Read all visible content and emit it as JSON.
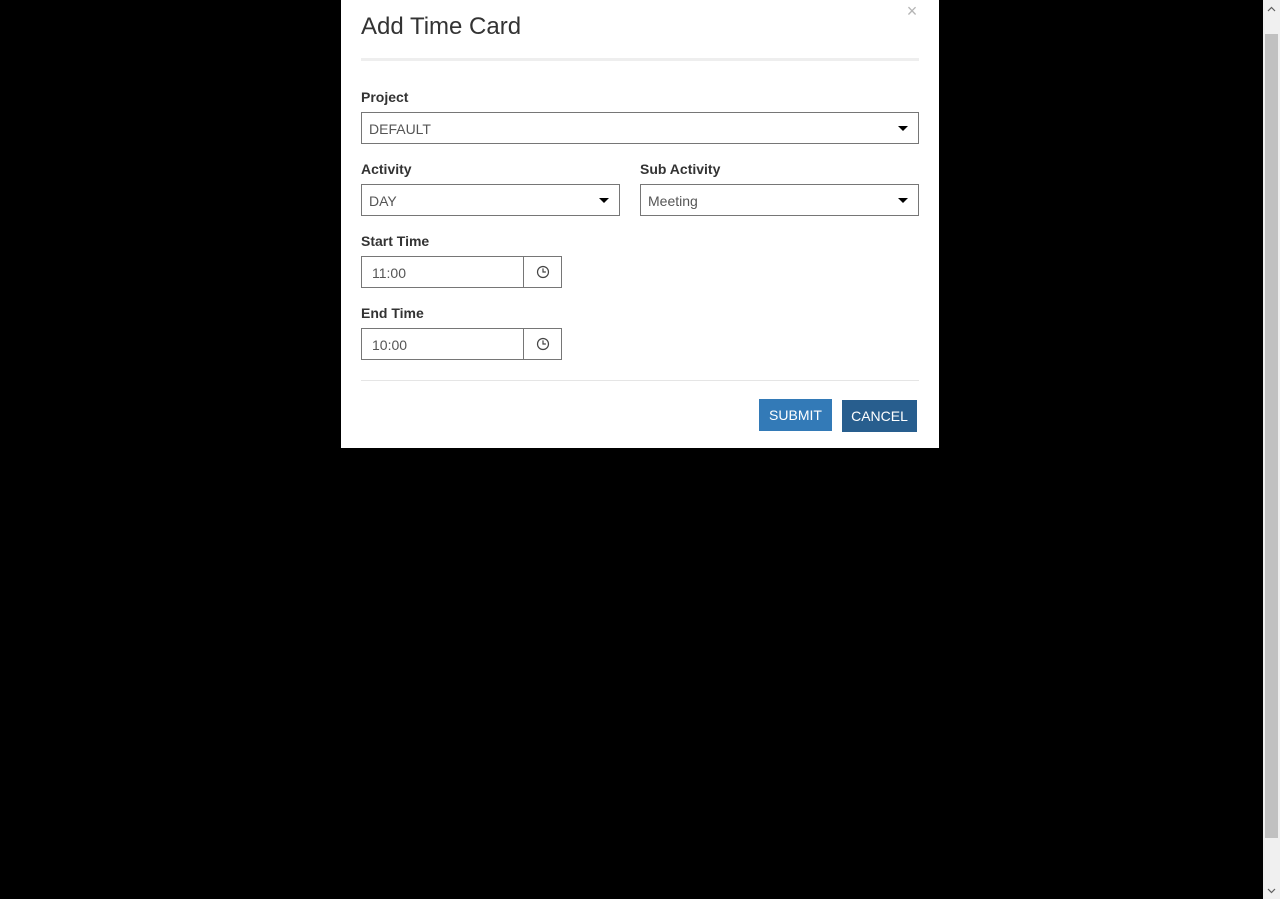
{
  "modal": {
    "title": "Add Time Card",
    "close_label": "×"
  },
  "form": {
    "project": {
      "label": "Project",
      "value": "DEFAULT"
    },
    "activity": {
      "label": "Activity",
      "value": "DAY"
    },
    "sub_activity": {
      "label": "Sub Activity",
      "value": "Meeting"
    },
    "start_time": {
      "label": "Start Time",
      "value": "11:00"
    },
    "end_time": {
      "label": "End Time",
      "value": "10:00"
    }
  },
  "buttons": {
    "submit_label": "SUBMIT",
    "cancel_label": "CANCEL"
  },
  "icons": {
    "dropdown": "chevron-down-icon",
    "time": "clock-icon",
    "close": "close-icon"
  },
  "colors": {
    "submit": "#337ab7",
    "cancel": "#285e8e",
    "backdrop": "#000000"
  }
}
